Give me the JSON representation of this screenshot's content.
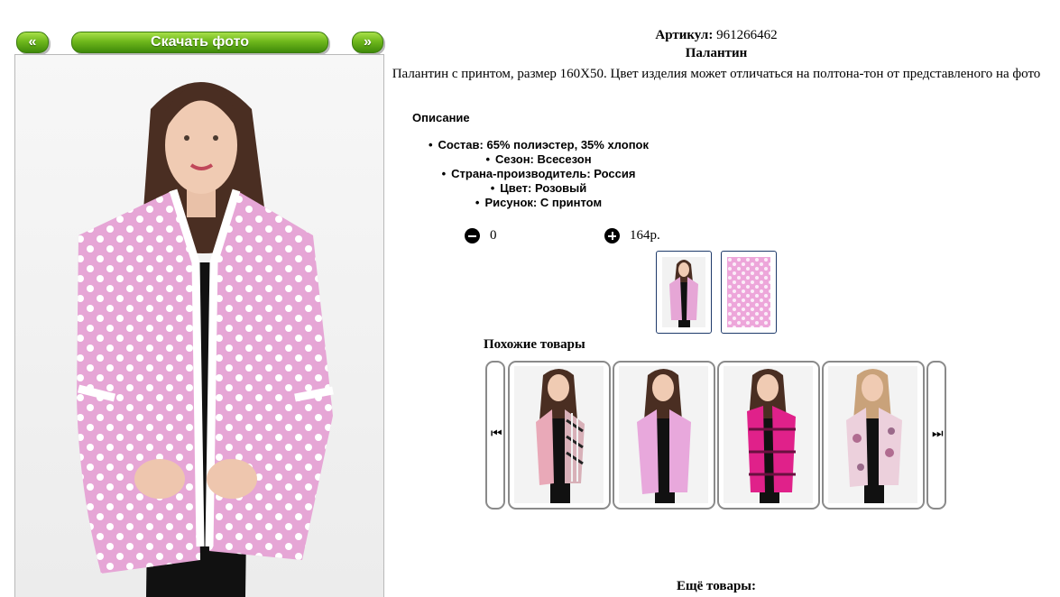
{
  "nav": {
    "prev_label": "«",
    "download_label": "Скачать фото",
    "next_label": "»"
  },
  "product": {
    "article_label": "Артикул:",
    "article_value": "961266462",
    "name": "Палантин",
    "description": "Палантин с принтом, размер 160Х50. Цвет изделия может отличаться на полтона-тон от представленого на фото",
    "description_heading": "Описание",
    "properties": [
      "Состав: 65% полиэстер, 35% хлопок",
      "Сезон: Всесезон",
      "Страна-производитель: Россия",
      "Цвет: Розовый",
      "Рисунок: С принтом"
    ]
  },
  "cart": {
    "quantity": "0",
    "price": "164р."
  },
  "similar": {
    "title": "Похожие товары",
    "prev_icon": "skip-previous-icon",
    "next_icon": "skip-next-icon"
  },
  "more": {
    "title": "Ещё товары:"
  },
  "colors": {
    "button_green": "#6fb81c",
    "scarf_pink": "#e6a6d6",
    "thumb_border": "#1e3a6a",
    "carousel_border": "#8a8a8a"
  }
}
